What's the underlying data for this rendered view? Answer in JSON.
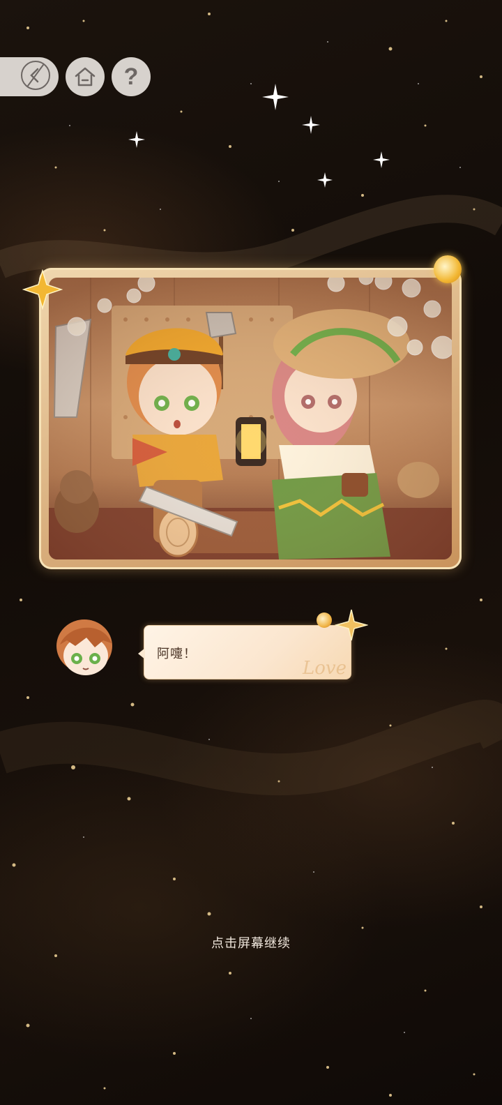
{
  "nav": {
    "back_icon": "back-arrow-icon",
    "home_icon": "home-icon",
    "help_label": "?"
  },
  "story_card": {
    "illustration": "two chibi characters in a woodshop with a saw, log and lantern"
  },
  "dialogue": {
    "text": "阿嚏！",
    "watermark": "Love"
  },
  "continue_hint": "点击屏幕继续",
  "colors": {
    "background": "#120c08",
    "button": "#d7d2cd",
    "button_icon": "#6d6764",
    "bubble": "#fbe6cf",
    "accent_gold": "#f2b733"
  }
}
